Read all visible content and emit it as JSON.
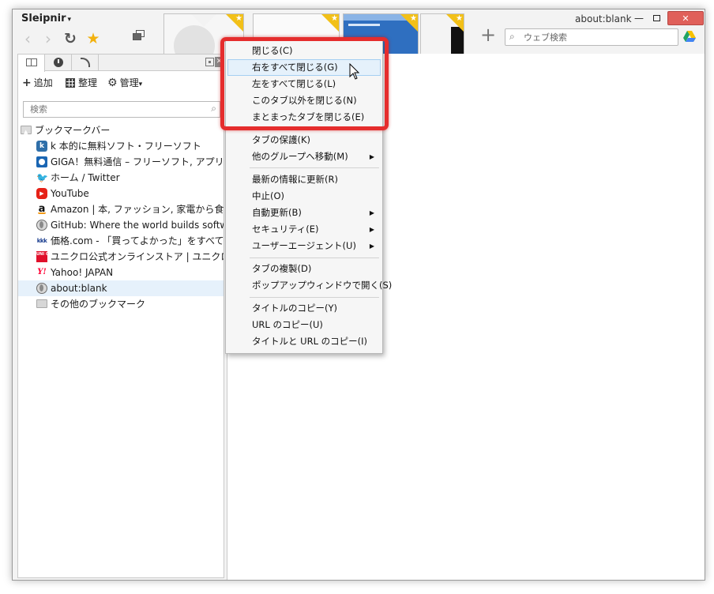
{
  "app": {
    "name": "Sleipnir",
    "menu_caret": "▾",
    "active_tab_title": "about:blank"
  },
  "toolbar": {
    "back_glyph": "‹",
    "forward_glyph": "›",
    "reload_glyph": "↻",
    "favorite_glyph": "★",
    "new_tab_glyph": "+"
  },
  "search": {
    "placeholder": "ウェブ検索"
  },
  "window_controls": {
    "minimize": "—",
    "close": "✕"
  },
  "sidebar": {
    "tabs": [
      "bookmarks-icon",
      "history-icon",
      "feed-icon"
    ],
    "actions": {
      "add": "追加",
      "organize": "整理",
      "manage": "管理",
      "manage_caret": "▾"
    },
    "search_placeholder": "検索",
    "tree": [
      {
        "label": "ブックマークバー",
        "icon": "bookmark-bar-folder-icon",
        "depth": 0
      },
      {
        "label": "k 本的に無料ソフト・フリーソフト",
        "icon": "k-favicon",
        "icon_text": "k",
        "depth": 1
      },
      {
        "label": "GIGA！無料通信 – フリーソフト, アプリ, 無料の",
        "icon": "giga-favicon",
        "depth": 1
      },
      {
        "label": "ホーム / Twitter",
        "icon": "twitter-favicon",
        "icon_text": "🐦",
        "depth": 1
      },
      {
        "label": "YouTube",
        "icon": "youtube-favicon",
        "icon_text": "▶",
        "depth": 1
      },
      {
        "label": "Amazon | 本, ファッション, 家電から食品まで |",
        "icon": "amazon-favicon",
        "icon_text": "a",
        "depth": 1
      },
      {
        "label": "GitHub: Where the world builds software ·",
        "icon": "github-favicon",
        "depth": 1
      },
      {
        "label": "価格.com - 「買ってよかった」をすべてのひとに。",
        "icon": "kakaku-favicon",
        "icon_text": "kkk",
        "depth": 1
      },
      {
        "label": "ユニクロ公式オンラインストア | ユニクロ",
        "icon": "uniqlo-favicon",
        "icon_text": "UNI QLO",
        "depth": 1
      },
      {
        "label": "Yahoo! JAPAN",
        "icon": "yahoo-favicon",
        "icon_text": "Y!",
        "depth": 1
      },
      {
        "label": "about:blank",
        "icon": "globe-icon",
        "depth": 1,
        "selected": true
      },
      {
        "label": "その他のブックマーク",
        "icon": "folder-icon",
        "depth": 0
      }
    ]
  },
  "context_menu": {
    "items": [
      {
        "label": "閉じる(C)"
      },
      {
        "label": "右をすべて閉じる(G)",
        "hover": true
      },
      {
        "label": "左をすべて閉じる(L)"
      },
      {
        "label": "このタブ以外を閉じる(N)"
      },
      {
        "label": "まとまったタブを閉じる(E)"
      },
      {
        "separator": true
      },
      {
        "label": "タブの保護(K)"
      },
      {
        "label": "他のグループへ移動(M)",
        "submenu": true
      },
      {
        "separator": true
      },
      {
        "label": "最新の情報に更新(R)"
      },
      {
        "label": "中止(O)"
      },
      {
        "label": "自動更新(B)",
        "submenu": true
      },
      {
        "label": "セキュリティ(E)",
        "submenu": true
      },
      {
        "label": "ユーザーエージェント(U)",
        "submenu": true
      },
      {
        "separator": true
      },
      {
        "label": "タブの複製(D)"
      },
      {
        "label": "ポップアップウィンドウで開く(S)"
      },
      {
        "separator": true
      },
      {
        "label": "タイトルのコピー(Y)"
      },
      {
        "label": "URL のコピー(U)"
      },
      {
        "label": "タイトルと URL のコピー(I)"
      }
    ],
    "submenu_arrow": "▶"
  },
  "colors": {
    "highlight_border": "#e52d2d",
    "hover_bg": "#e5f1fb",
    "close_button": "#e0605a",
    "star": "#f2b10e"
  }
}
